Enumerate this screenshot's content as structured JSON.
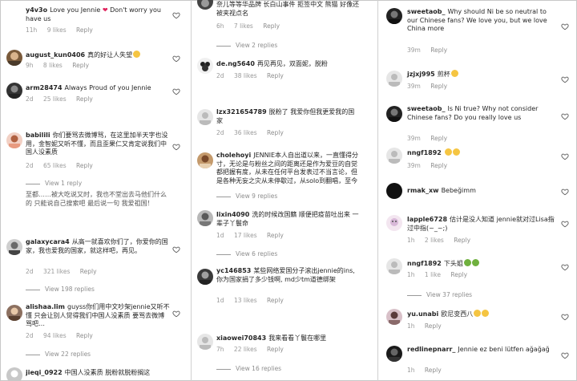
{
  "col1": {
    "c1": {
      "user": "y4v3o",
      "text_a": "Love you Jennie",
      "heart": "❤",
      "text_b": "Don't worry you have us",
      "time": "11h",
      "likes": "9 likes",
      "reply": "Reply"
    },
    "c2": {
      "user": "august_kun0406",
      "text": "真的好让人失望",
      "emoji": "😔",
      "time": "9h",
      "likes": "8 likes",
      "reply": "Reply"
    },
    "c3": {
      "user": "arm28474",
      "text": "Always Proud of you Jennie",
      "time": "2d",
      "likes": "25 likes",
      "reply": "Reply"
    },
    "c4": {
      "user": "babilili",
      "text": "你们要骂去微博骂，在这里加半天字也没用，金智妮又听不懂，而且歪果仁又肯定说我们中国人没素质",
      "time": "2d",
      "likes": "65 likes",
      "reply": "Reply"
    },
    "c4_view": "View 1 reply",
    "c5_cut": "至都……被大吃说又时，我也不堂出去马他们什么的 只能说自己搜索吧 最后说一句 我爱祖国！",
    "c6": {
      "user": "galaxycara4",
      "text": "从高一就喜欢你们了，你爱你的国家，我也爱我的国家，就这样吧，再见。",
      "time": "2d",
      "likes": "321 likes",
      "reply": "Reply"
    },
    "c6_view": "View 198 replies",
    "c7": {
      "user": "alishaa.lim",
      "text": "guyss你们用中文吵架jennie又听不懂 只会让别人觉得我们中国人没素质 要骂去微博骂吧…",
      "time": "2d",
      "likes": "94 likes",
      "reply": "Reply"
    },
    "c7_view": "View 22 replies",
    "c8": {
      "user": "jieqi_0922",
      "text": "中国人没素质 脱粉就脱粉搁这"
    }
  },
  "col2": {
    "c0": {
      "text": "奈儿等等华品牌 长白山事件 拒签中文 熊猫 好像还被夹视点名",
      "time": "6h",
      "likes": "7 likes",
      "reply": "Reply"
    },
    "c0_view": "View 2 replies",
    "c1": {
      "user": "de.ng5640",
      "text": "再见再见，双面妮，脱粉",
      "time": "2d",
      "likes": "38 likes",
      "reply": "Reply"
    },
    "c2": {
      "user": "lzx321654789",
      "text": "脱粉了 我爱你但我更爱我的国家",
      "time": "2d",
      "likes": "36 likes",
      "reply": "Reply"
    },
    "c3": {
      "user": "cholehoyi",
      "text": "JENNIE本人自出道以来，一直懂得分寸，无论是与粉丝之间的距离还是作为爱豆的自觉都把握有度，从未在任何平台发表过不当言论，但是各种无妄之灾从未停歇过，从solo到翻唱，至今无数的",
      "view": "View 9 replies"
    },
    "c4": {
      "user": "lixin4090",
      "text": "洗的时候改国籍 顺便把疫苗吐出来 一辈子丫鬟命",
      "time": "1d",
      "likes": "17 likes",
      "reply": "Reply"
    },
    "c4_view": "View 6 replies",
    "c5": {
      "user": "yc146853",
      "text": "某些网络爱国分子滚出jennie的ins, 你为国家捐了多少钱啊, md少tm道德绑架",
      "time": "1d",
      "likes": "13 likes",
      "reply": "Reply"
    },
    "c6": {
      "user": "xiaowei70843",
      "text": "我来看看丫鬟在哪里",
      "time": "7h",
      "likes": "22 likes",
      "reply": "Reply"
    },
    "c6_view": "View 16 replies",
    "c7_cut": "…"
  },
  "col3": {
    "c1": {
      "user": "sweetaob_",
      "text": "Why should Ni be so neutral to our Chinese fans? We love you, but we love China more",
      "time": "39m",
      "reply": "Reply"
    },
    "c2": {
      "user": "jzjxj995",
      "text": "煎杯",
      "time": "39m",
      "reply": "Reply"
    },
    "c3": {
      "user": "sweetaob_",
      "text": "Is Ni true? Why not consider Chinese fans? Do you really love us",
      "time": "39m",
      "reply": "Reply"
    },
    "c4": {
      "user": "nngf1892",
      "text": "",
      "time": "39m",
      "reply": "Reply"
    },
    "c5": {
      "user": "rmak_xw",
      "text": "Bebeğimm"
    },
    "c6": {
      "user": "lapple6728",
      "text": "估计是没人知道 jennie就对过Lisa指过中指(~_~;)",
      "time": "1h",
      "likes": "2 likes",
      "reply": "Reply"
    },
    "c7": {
      "user": "nngf1892",
      "text": "下头姐",
      "time": "1h",
      "likes": "1 like",
      "reply": "Reply"
    },
    "c7_view": "View 37 replies",
    "c8": {
      "user": "yu.unabi",
      "text": "欧尼变西八",
      "time": "1h",
      "reply": "Reply"
    },
    "c9": {
      "user": "redlinepnarr_",
      "text": "Jennie ez beni lütfen ağağağ",
      "time": "1h",
      "reply": "Reply"
    }
  },
  "colors": {
    "heart_red": "#e0245e",
    "emoji_yellow": "#f5c542",
    "emoji_green": "#6fb03e",
    "meta_gray": "#9a9a9a"
  }
}
